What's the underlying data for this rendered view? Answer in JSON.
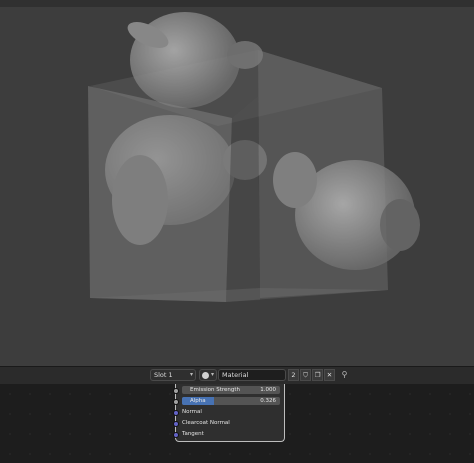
{
  "header": {
    "slot_label": "Slot 1",
    "material_name": "Material",
    "users_count": "2"
  },
  "node": {
    "inputs": [
      {
        "label": "Emission Strength",
        "value": "1.000"
      },
      {
        "label": "Alpha",
        "value": "0.326",
        "fill_fraction": 0.326
      }
    ],
    "sockets": [
      "Normal",
      "Clearcoat Normal",
      "Tangent"
    ]
  },
  "icons": [
    "material-ball-icon",
    "shield-icon",
    "duplicate-icon",
    "close-icon",
    "pin-icon",
    "chevron-down-icon"
  ],
  "colors": {
    "accent": "#4772b3",
    "socket_vector": "#6363c7",
    "viewport_bg": "#3d3d3d"
  }
}
